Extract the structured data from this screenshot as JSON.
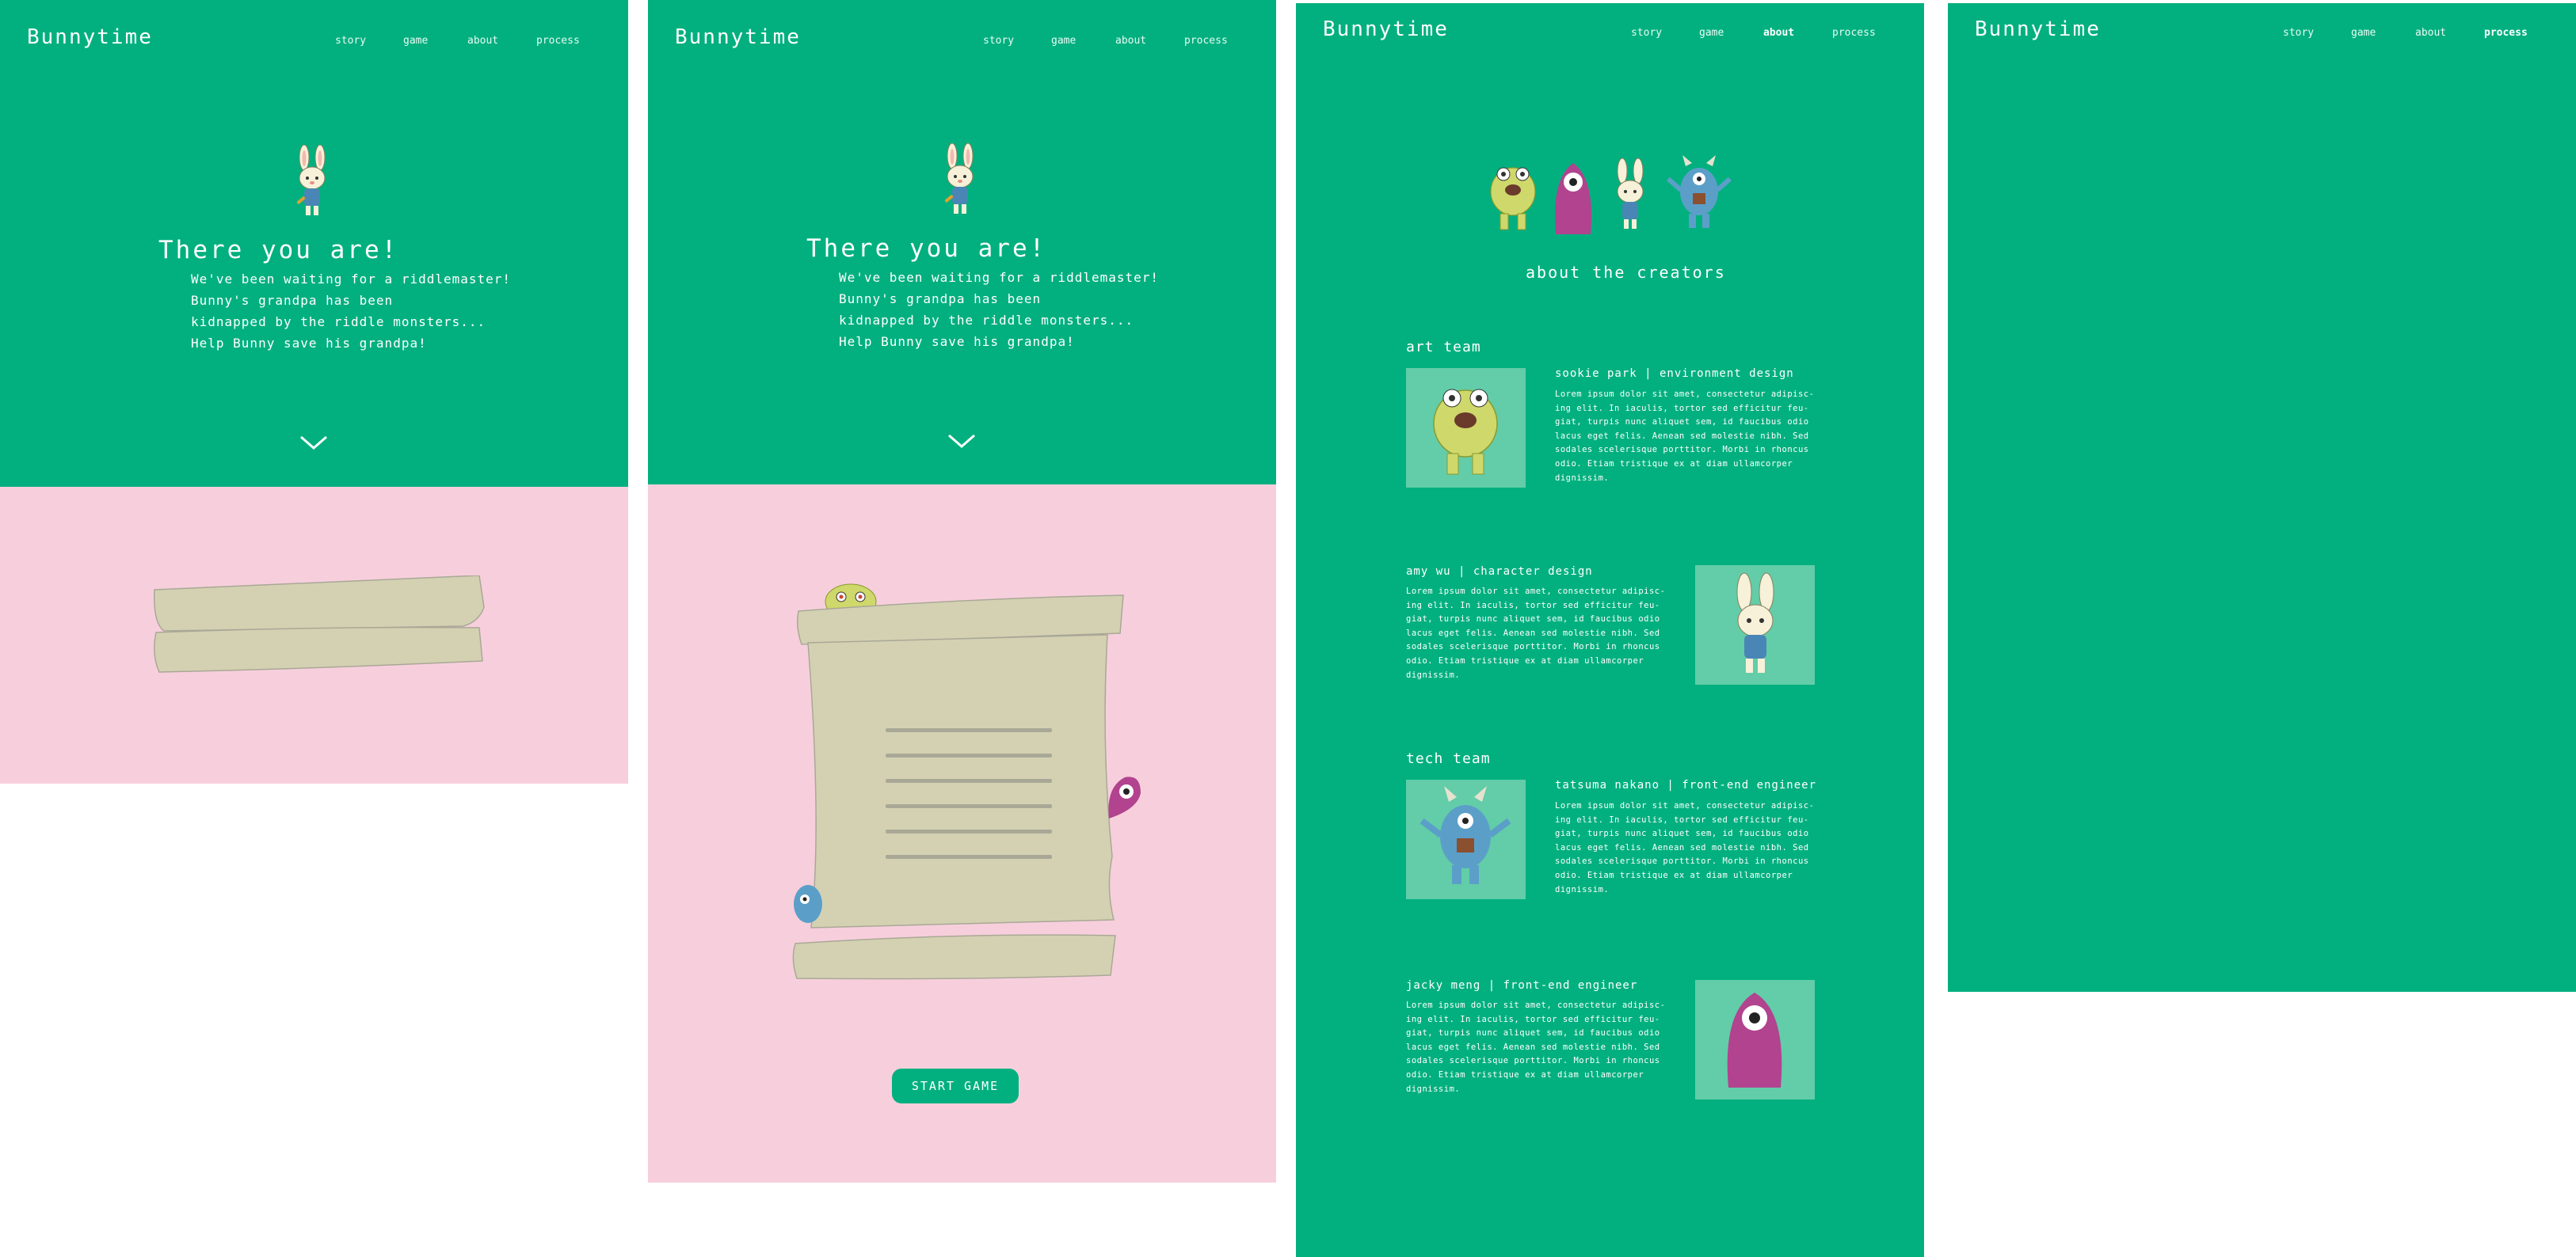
{
  "site": {
    "logo": "Bunnytime",
    "nav": [
      "story",
      "game",
      "about",
      "process"
    ]
  },
  "story": {
    "title": "There you are!",
    "lines": [
      "We've been waiting for a riddlemaster!",
      "Bunny's grandpa has been",
      "kidnapped by the riddle monsters...",
      "Help Bunny save his grandpa!"
    ]
  },
  "game": {
    "start_label": "START GAME"
  },
  "about": {
    "heading": "about the creators",
    "art_team_label": "art team",
    "tech_team_label": "tech team",
    "members": [
      {
        "name": "sookie park | environment design",
        "bio": "Lorem ipsum dolor sit amet, consectetur adipisc-ing elit. In iaculis, tortor sed efficitur feu-giat, turpis nunc aliquet sem, id faucibus odio lacus eget felis. Aenean sed molestie nibh. Sed sodales scelerisque porttitor. Morbi in rhoncus odio. Etiam tristique ex at diam ullamcorper dignissim."
      },
      {
        "name": "amy wu | character design",
        "bio": "Lorem ipsum dolor sit amet, consectetur adipisc-ing elit. In iaculis, tortor sed efficitur feu-giat, turpis nunc aliquet sem, id faucibus odio lacus eget felis. Aenean sed molestie nibh. Sed sodales scelerisque porttitor. Morbi in rhoncus odio. Etiam tristique ex at diam ullamcorper dignissim."
      },
      {
        "name": "tatsuma nakano | front-end engineer",
        "bio": "Lorem ipsum dolor sit amet, consectetur adipisc-ing elit. In iaculis, tortor sed efficitur feu-giat, turpis nunc aliquet sem, id faucibus odio lacus eget felis. Aenean sed molestie nibh. Sed sodales scelerisque porttitor. Morbi in rhoncus odio. Etiam tristique ex at diam ullamcorper dignissim."
      },
      {
        "name": "jacky meng | front-end engineer",
        "bio": "Lorem ipsum dolor sit amet, consectetur adipisc-ing elit. In iaculis, tortor sed efficitur feu-giat, turpis nunc aliquet sem, id faucibus odio lacus eget felis. Aenean sed molestie nibh. Sed sodales scelerisque porttitor. Morbi in rhoncus odio. Etiam tristique ex at diam ullamcorper dignissim."
      }
    ]
  },
  "icons": {
    "scroll_down": "chevron-down-icon",
    "bunny": "bunny-character-icon",
    "frog_monster": "yellow-monster-icon",
    "cyclops_monster": "purple-monster-icon",
    "horn_monster": "blue-monster-icon"
  },
  "colors": {
    "brand_green": "#02b07f",
    "pink_background": "#f7cfdc",
    "scroll_paper": "#d4d1b3",
    "portrait_background": "#62cda8"
  }
}
